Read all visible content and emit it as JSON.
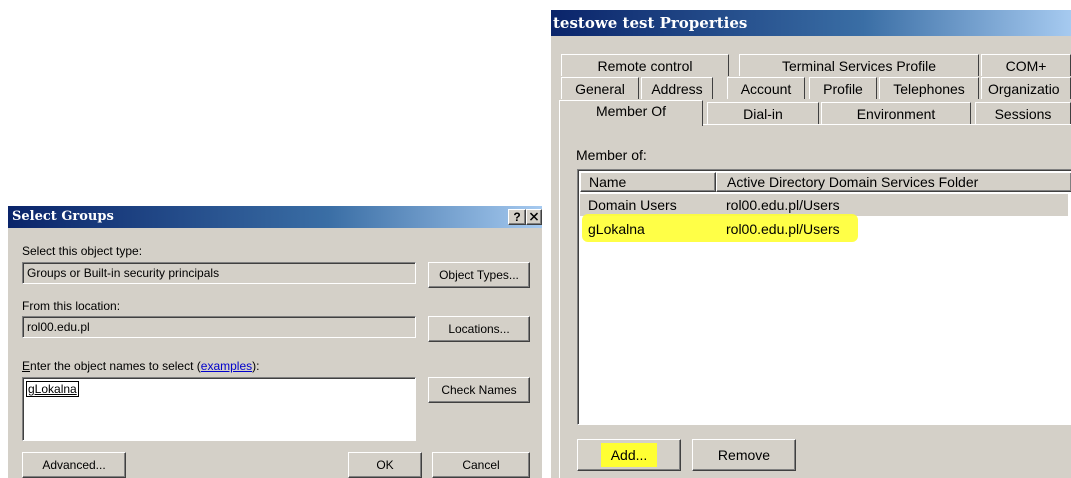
{
  "select_groups": {
    "title": "Select Groups",
    "help_label": "?",
    "close_label": "×",
    "object_type_label": "Select this object type:",
    "object_type_value": "Groups or Built-in security principals",
    "object_types_button": "Object Types...",
    "location_label": "From this location:",
    "location_value": "rol00.edu.pl",
    "locations_button": "Locations...",
    "enter_label_prefix": "nter the object names to select (",
    "enter_label_accel": "E",
    "examples_link": "examples",
    "enter_label_suffix": "):",
    "names_value": "gLokalna",
    "check_names_button": "Check Names",
    "advanced_button": "Advanced...",
    "ok_button": "OK",
    "cancel_button": "Cancel"
  },
  "properties": {
    "title": "testowe test Properties",
    "tabs_row1": [
      "Remote control",
      "Terminal Services Profile",
      "COM+"
    ],
    "tabs_row2": [
      "General",
      "Address",
      "Account",
      "Profile",
      "Telephones",
      "Organizatio"
    ],
    "tabs_row3": [
      "Member Of",
      "Dial-in",
      "Environment",
      "Sessions"
    ],
    "member_of_label": "Member of:",
    "columns": [
      "Name",
      "Active Directory Domain Services Folder"
    ],
    "rows": [
      {
        "name": "Domain Users",
        "folder": "rol00.edu.pl/Users"
      },
      {
        "name": "gLokalna",
        "folder": "rol00.edu.pl/Users"
      }
    ],
    "add_button": "Add...",
    "remove_button": "Remove"
  },
  "colors": {
    "dialog_bg": "#d4d0c8",
    "title_start": "#0a246a",
    "highlight": "#ffff33"
  }
}
